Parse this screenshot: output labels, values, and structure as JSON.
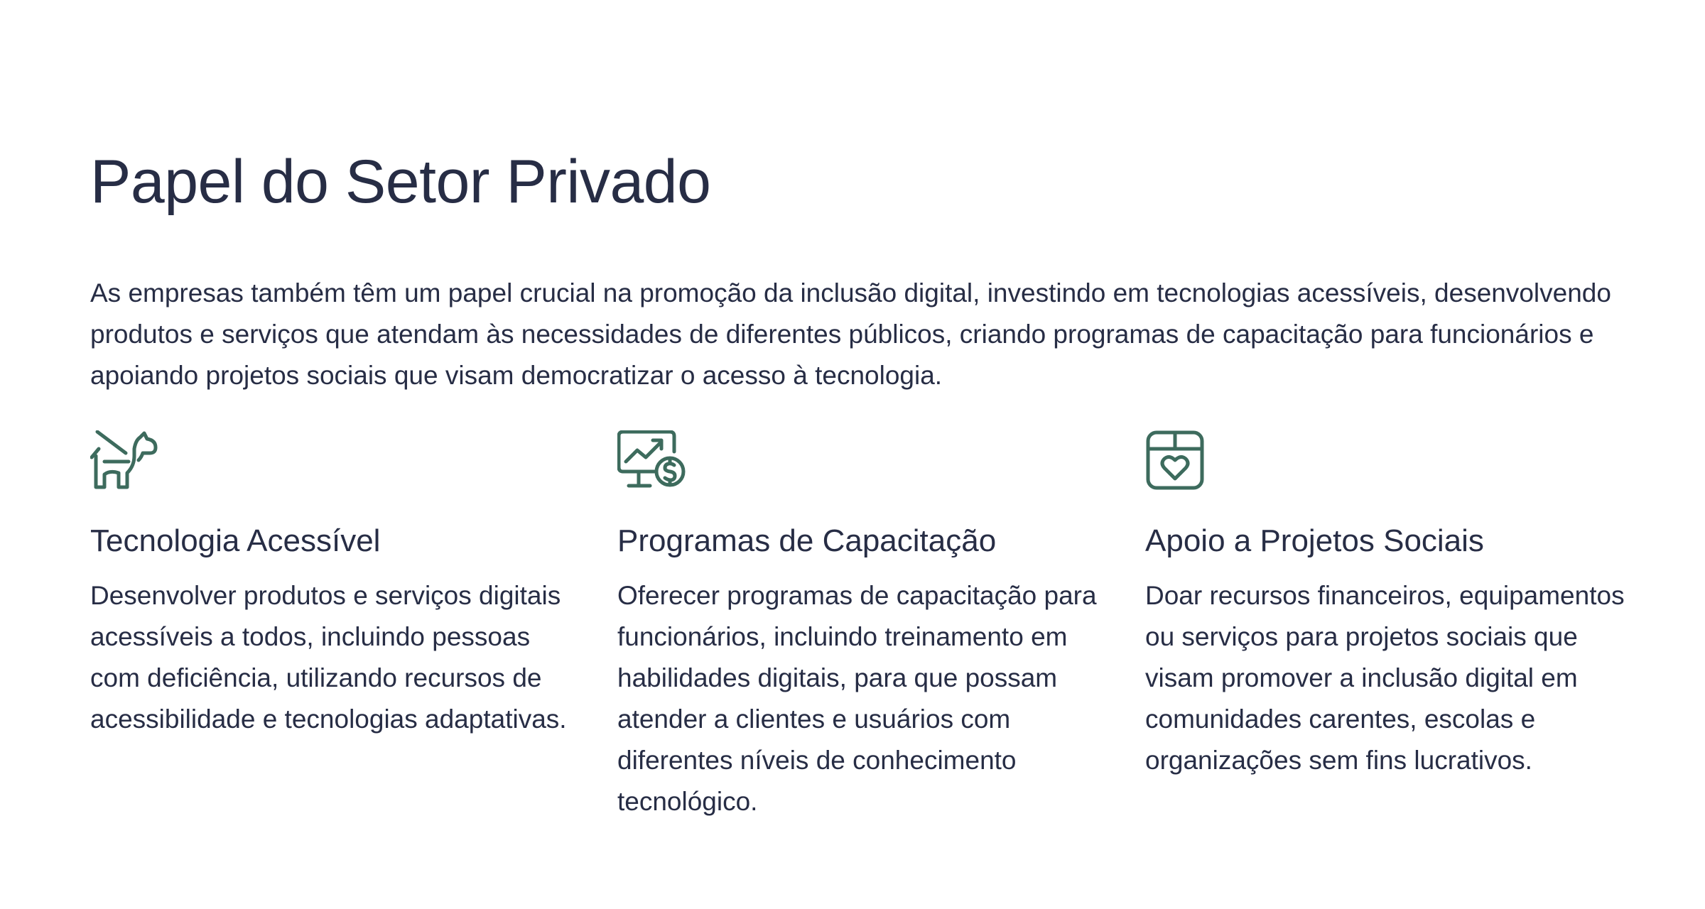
{
  "title": "Papel do Setor Privado",
  "intro": "As empresas também têm um papel crucial na promoção da inclusão digital, investindo em tecnologias acessíveis, desenvolvendo produtos e serviços que atendam às necessidades de diferentes públicos, criando programas de capacitação para funcionários e apoiando projetos sociais que visam democratizar o acesso à tecnologia.",
  "accent_color": "#3d6b5d",
  "text_color": "#272d45",
  "columns": [
    {
      "icon": "guide-dog-icon",
      "title": "Tecnologia Acessível",
      "text": "Desenvolver produtos e serviços digitais acessíveis a todos, incluindo pessoas com deficiência, utilizando recursos de acessibilidade e tecnologias adaptativas."
    },
    {
      "icon": "monitor-chart-dollar-icon",
      "title": "Programas de Capacitação",
      "text": "Oferecer programas de capacitação para funcionários, incluindo treinamento em habilidades digitais, para que possam atender a clientes e usuários com diferentes níveis de conhecimento tecnológico."
    },
    {
      "icon": "box-heart-icon",
      "title": "Apoio a Projetos Sociais",
      "text": "Doar recursos financeiros, equipamentos ou serviços para projetos sociais que visam promover a inclusão digital em comunidades carentes, escolas e organizações sem fins lucrativos."
    }
  ]
}
